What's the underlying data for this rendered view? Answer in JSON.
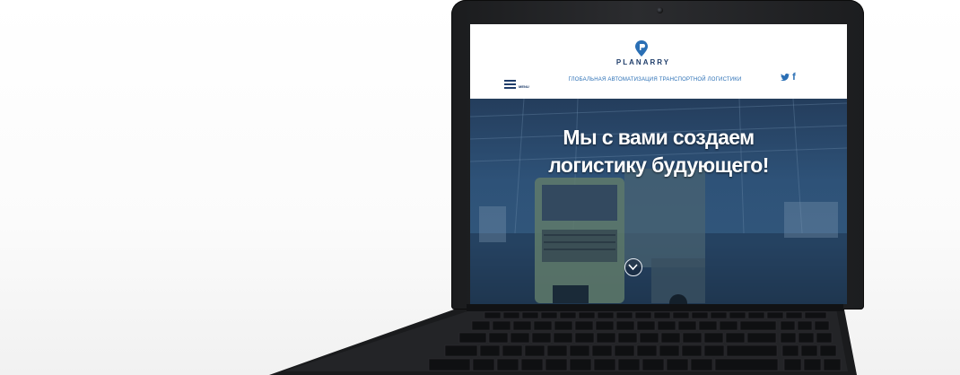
{
  "site": {
    "logo_text": "PLANARRY",
    "menu_label": "MENU",
    "tagline": "ГЛОБАЛЬНАЯ АВТОМАТИЗАЦИЯ ТРАНСПОРТНОЙ ЛОГИСТИКИ",
    "social": {
      "twitter": "𝕪",
      "facebook": "f"
    }
  },
  "hero": {
    "title_line1": "Мы с вами создаем",
    "title_line2": "логистику будующего!"
  },
  "colors": {
    "brand_dark": "#1f3d6a",
    "brand_light": "#2a6fb5",
    "hero_overlay": "#2e5278",
    "laptop_body": "#1b1c1e"
  }
}
